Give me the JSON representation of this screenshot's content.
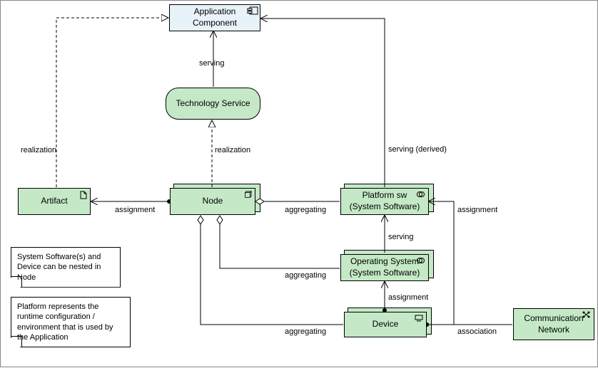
{
  "nodes": {
    "appComponent": "Application\nComponent",
    "techService": "Technology Service",
    "artifact": "Artifact",
    "node": "Node",
    "platformSw": "Platform sw\n(System Software)",
    "os": "Operating System\n(System Software)",
    "device": "Device",
    "commNetwork": "Communication\nNetwork"
  },
  "labels": {
    "serving1": "serving",
    "realization1": "realization",
    "realization2": "realization",
    "assignment1": "assignment",
    "aggregating1": "aggregating",
    "servingDerived": "serving (derived)",
    "assignment2": "assignment",
    "serving2": "serving",
    "aggregating2": "aggregating",
    "assignment3": "assignment",
    "association": "association",
    "aggregating3": "aggregating"
  },
  "notes": {
    "note1": "System Software(s) and Device can be nested in Node",
    "note2": "Platform represents the runtime configuration / environment that is used by the Application"
  }
}
